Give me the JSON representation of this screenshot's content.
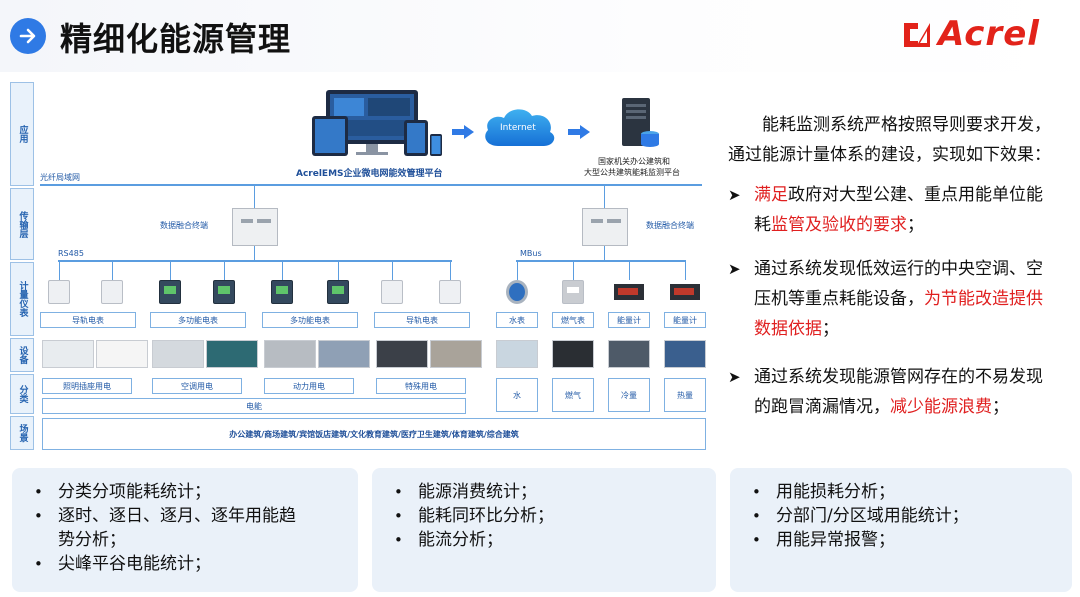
{
  "header": {
    "title": "精细化能源管理",
    "logo_text": "Acrel",
    "accent": "#2f7ae5",
    "logo_color": "#e2231a"
  },
  "diagram": {
    "tiers": [
      "应用",
      "传输层",
      "计量仪表",
      "设备",
      "分类",
      "场景"
    ],
    "platform_label": "AcrelEMS企业微电网能效管理平台",
    "internet_label": "Internet",
    "gov_label_1": "国家机关办公建筑和",
    "gov_label_2": "大型公共建筑能耗监测平台",
    "network_label": "光纤局域网",
    "terminal_label_left": "数据融合终端",
    "terminal_label_right": "数据融合终端",
    "bus_left": "RS485",
    "bus_right": "MBus",
    "meters_left": [
      "导轨电表",
      "多功能电表",
      "多功能电表",
      "导轨电表"
    ],
    "meters_right": [
      "水表",
      "燃气表",
      "能量计",
      "能量计"
    ],
    "categories_left": [
      "照明插座用电",
      "空调用电",
      "动力用电",
      "特殊用电"
    ],
    "categories_right": [
      "水",
      "燃气",
      "冷量",
      "热量"
    ],
    "electricity_label": "电能",
    "scene_label": "办公建筑/商场建筑/宾馆饭店建筑/文化教育建筑/医疗卫生建筑/体育建筑/综合建筑"
  },
  "right_text": {
    "intro_1": "能耗监测系统严格按照导则要求开发，",
    "intro_2": "通过能源计量体系的建设，实现如下效果：",
    "b1_red1": "满足",
    "b1_text1": "政府对大型公建、重点用能单位能",
    "b1_text2": "耗",
    "b1_red2": "监管及验收的要求",
    "b1_end": "；",
    "b2_text1": "通过系统发现低效运行的中央空调、空",
    "b2_text2": "压机等重点耗能设备，",
    "b2_red1": "为节能改造提供",
    "b2_red2": "数据依据",
    "b2_end": "；",
    "b3_text1": "通过系统发现能源管网存在的不易发现",
    "b3_text2": "的跑冒滴漏情况，",
    "b3_red": "减少能源浪费",
    "b3_end": "；"
  },
  "panels": [
    [
      "分类分项能耗统计；",
      "逐时、逐日、逐月、逐年用能趋",
      "势分析；",
      "尖峰平谷电能统计；"
    ],
    [
      "能源消费统计；",
      "能耗同环比分析；",
      "能流分析；"
    ],
    [
      "用能损耗分析；",
      "分部门/分区域用能统计；",
      "用能异常报警；"
    ]
  ]
}
